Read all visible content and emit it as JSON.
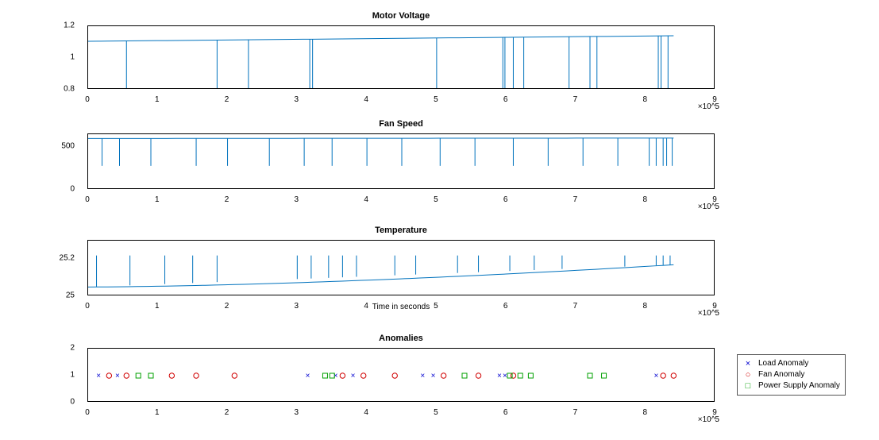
{
  "chart_data": [
    {
      "type": "line",
      "title": "Motor Voltage",
      "xlabel": "",
      "ylabel": "",
      "xlim": [
        0,
        900000
      ],
      "ylim": [
        0.8,
        1.2
      ],
      "xticks": [
        0,
        1,
        2,
        3,
        4,
        5,
        6,
        7,
        8,
        9
      ],
      "xtick_scale_label": "×10^5",
      "yticks": [
        0.8,
        1.0,
        1.2
      ],
      "baseline_start": 1.105,
      "baseline_end": 1.14,
      "spikes_x": [
        55000,
        185000,
        230000,
        318000,
        322000,
        500000,
        595000,
        598000,
        610000,
        625000,
        690000,
        720000,
        730000,
        818000,
        822000,
        832000
      ],
      "spike_low": 0.8
    },
    {
      "type": "line",
      "title": "Fan Speed",
      "xlabel": "",
      "ylabel": "",
      "xlim": [
        0,
        900000
      ],
      "ylim": [
        0,
        650
      ],
      "xticks": [
        0,
        1,
        2,
        3,
        4,
        5,
        6,
        7,
        8,
        9
      ],
      "xtick_scale_label": "×10^5",
      "yticks": [
        0,
        500
      ],
      "baseline_start": 600,
      "baseline_end": 605,
      "spikes_x": [
        20000,
        45000,
        90000,
        155000,
        200000,
        260000,
        310000,
        350000,
        400000,
        450000,
        505000,
        555000,
        610000,
        660000,
        710000,
        760000,
        805000,
        815000,
        825000,
        830000,
        838000
      ],
      "spike_low": 280
    },
    {
      "type": "line",
      "title": "Temperature",
      "xlabel": "Time in seconds",
      "ylabel": "",
      "xlim": [
        0,
        900000
      ],
      "ylim": [
        25.0,
        25.3
      ],
      "xticks": [
        0,
        1,
        2,
        3,
        4,
        5,
        6,
        7,
        8,
        9
      ],
      "xtick_scale_label": "×10^5",
      "yticks": [
        25.0,
        25.2
      ],
      "baseline_start": 25.05,
      "baseline_end": 25.17,
      "spikes_x": [
        12000,
        60000,
        110000,
        150000,
        185000,
        300000,
        320000,
        345000,
        365000,
        385000,
        440000,
        470000,
        530000,
        560000,
        605000,
        640000,
        680000,
        770000,
        815000,
        825000,
        835000
      ],
      "spike_high": 25.22
    },
    {
      "type": "scatter",
      "title": "Anomalies",
      "xlabel": "",
      "ylabel": "",
      "xlim": [
        0,
        900000
      ],
      "ylim": [
        0,
        2
      ],
      "xticks": [
        0,
        1,
        2,
        3,
        4,
        5,
        6,
        7,
        8,
        9
      ],
      "xtick_scale_label": "×10^5",
      "yticks": [
        0,
        1,
        2
      ],
      "series": [
        {
          "name": "Load Anomaly",
          "marker": "x",
          "color": "#0000d0",
          "x": [
            15000,
            42000,
            315000,
            355000,
            380000,
            480000,
            495000,
            590000,
            598000,
            815000
          ],
          "y": 1
        },
        {
          "name": "Fan Anomaly",
          "marker": "o",
          "color": "#d00000",
          "x": [
            30000,
            55000,
            120000,
            155000,
            210000,
            365000,
            395000,
            440000,
            510000,
            560000,
            610000,
            825000,
            840000
          ],
          "y": 1
        },
        {
          "name": "Power Supply Anomaly",
          "marker": "s",
          "color": "#00a000",
          "x": [
            72000,
            90000,
            340000,
            350000,
            540000,
            605000,
            620000,
            635000,
            720000,
            740000
          ],
          "y": 1
        }
      ]
    }
  ],
  "legend": {
    "items": [
      {
        "label": "Load Anomaly",
        "symbol": "×",
        "color": "#0000d0"
      },
      {
        "label": "Fan Anomaly",
        "symbol": "○",
        "color": "#d00000"
      },
      {
        "label": "Power Supply Anomaly",
        "symbol": "□",
        "color": "#00a000"
      }
    ]
  }
}
